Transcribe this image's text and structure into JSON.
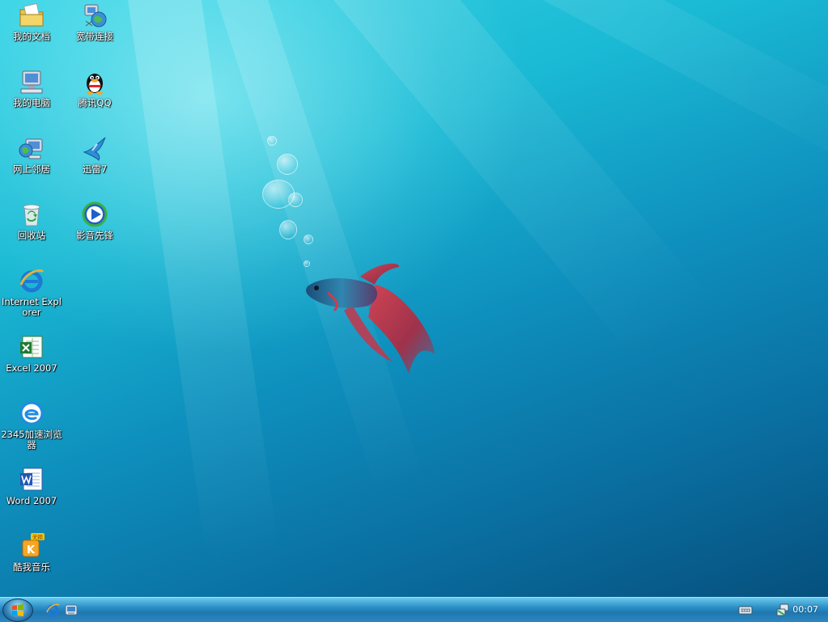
{
  "desktop": {
    "icons_col1": [
      {
        "label": "我的文档",
        "icon": "my-documents-folder-icon"
      },
      {
        "label": "我的电脑",
        "icon": "my-computer-icon"
      },
      {
        "label": "网上邻居",
        "icon": "network-neighborhood-icon"
      },
      {
        "label": "回收站",
        "icon": "recycle-bin-icon"
      },
      {
        "label": "Internet Explorer",
        "icon": "internet-explorer-icon"
      },
      {
        "label": "Excel 2007",
        "icon": "excel-icon"
      },
      {
        "label": "2345加速浏览器",
        "icon": "2345-browser-icon"
      },
      {
        "label": "Word 2007",
        "icon": "word-icon"
      },
      {
        "label": "酷我音乐",
        "icon": "kuwo-music-icon"
      }
    ],
    "icons_col2": [
      {
        "label": "宽带连接",
        "icon": "broadband-connection-icon"
      },
      {
        "label": "腾讯QQ",
        "icon": "qq-penguin-icon"
      },
      {
        "label": "迅雷7",
        "icon": "xunlei-bird-icon"
      },
      {
        "label": "影音先锋",
        "icon": "xfplay-player-icon"
      }
    ],
    "kuwo_badge": "无损"
  },
  "taskbar": {
    "start_button": "windows-start-orb-icon",
    "quick_launch": [
      "internet-explorer-icon",
      "show-desktop-icon"
    ],
    "tray_icons": [
      "keyboard-icon",
      "network-icon"
    ],
    "clock": "00:07"
  },
  "colors": {
    "wallpaper_top": "#37d4e6",
    "wallpaper_bottom": "#06507d",
    "taskbar": "#2a8fc6"
  }
}
